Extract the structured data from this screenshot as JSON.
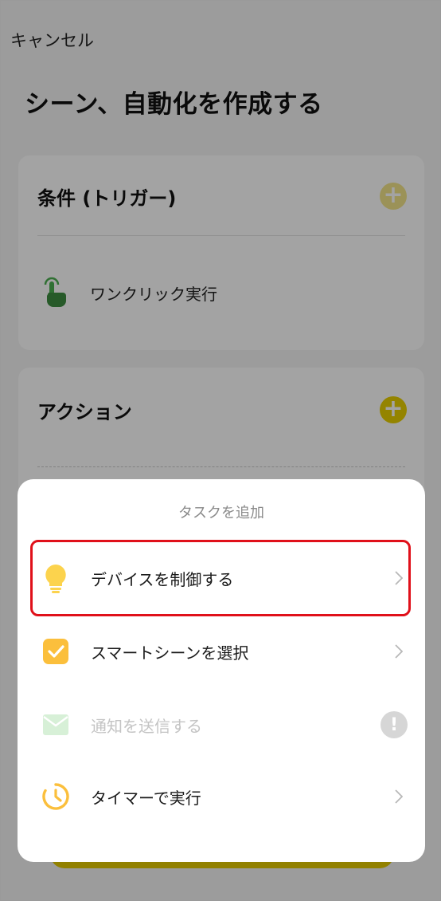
{
  "header": {
    "cancel_label": "キャンセル",
    "title": "シーン、自動化を作成する"
  },
  "trigger_card": {
    "heading": "条件 (トリガー)",
    "add_icon": "plus-icon",
    "items": [
      {
        "label": "ワンクリック実行",
        "icon": "tap-hand-icon"
      }
    ]
  },
  "action_card": {
    "heading": "アクション",
    "add_icon": "plus-icon"
  },
  "sheet": {
    "title": "タスクを追加",
    "options": [
      {
        "label": "デバイスを制御する",
        "icon": "lightbulb-icon",
        "enabled": true,
        "highlighted": true
      },
      {
        "label": "スマートシーンを選択",
        "icon": "checkbox-icon",
        "enabled": true
      },
      {
        "label": "通知を送信する",
        "icon": "mail-icon",
        "enabled": false,
        "badge": "!"
      },
      {
        "label": "タイマーで実行",
        "icon": "timer-icon",
        "enabled": true
      }
    ]
  },
  "colors": {
    "accent_yellow": "#e8cf00",
    "highlight_red": "#e0101a",
    "bulb_yellow": "#fcd34d",
    "checkbox_yellow": "#fbbf3c",
    "mail_green_disabled": "#d7f0d7",
    "trigger_green": "#4caf50"
  }
}
